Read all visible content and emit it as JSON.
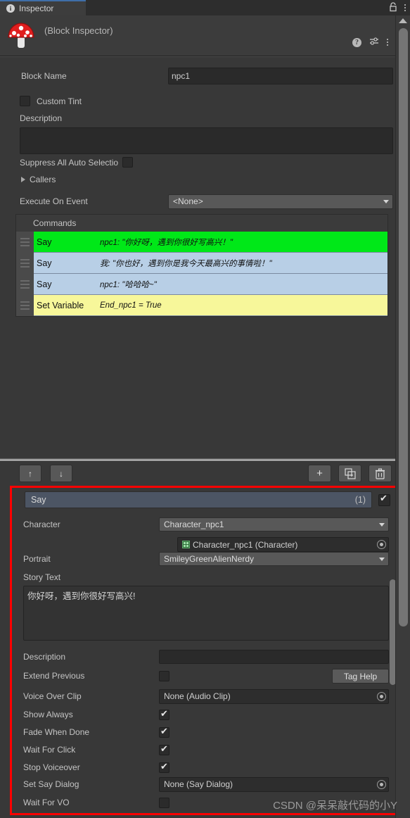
{
  "window": {
    "tab_label": "Inspector",
    "tab_icon": "info-icon",
    "lock_icon": "lock-icon",
    "tab_menu_icon": "kebab-menu-icon"
  },
  "header": {
    "title": "(Block Inspector)",
    "logo_icon": "mushroom-icon",
    "help_icon": "help-icon",
    "preset_icon": "preset-sliders-icon",
    "menu_icon": "kebab-menu-icon"
  },
  "block": {
    "block_name_label": "Block Name",
    "block_name_value": "npc1",
    "custom_tint_label": "Custom Tint",
    "custom_tint_checked": false,
    "description_label": "Description",
    "description_value": "",
    "suppress_label": "Suppress All Auto Selectio",
    "suppress_checked": false,
    "callers_label": "Callers",
    "execute_on_event_label": "Execute On Event",
    "execute_on_event_value": "<None>"
  },
  "commands": {
    "header": "Commands",
    "rows": [
      {
        "name": "Say",
        "summary": "npc1: \"你好呀，遇到你很好写高兴！\"",
        "color": "#00e818",
        "selected": true
      },
      {
        "name": "Say",
        "summary": "我: \"你也好，遇到你是我今天最高兴的事情啦！\"",
        "color": "#b8cfe6",
        "selected": false
      },
      {
        "name": "Say",
        "summary": "npc1: \"哈哈哈~\"",
        "color": "#b8cfe6",
        "selected": false
      },
      {
        "name": "Set Variable",
        "summary": "End_npc1 = True",
        "color": "#f7f79a",
        "selected": false
      }
    ]
  },
  "toolbar": {
    "move_up_label": "↑",
    "move_down_label": "↓",
    "add_label": "+",
    "duplicate_label": "duplicate-icon",
    "delete_label": "trash-icon"
  },
  "say_command": {
    "title": "Say",
    "index": "(1)",
    "enabled": true,
    "character_label": "Character",
    "character_value": "Character_npc1",
    "character_object_value": "Character_npc1 (Character)",
    "portrait_label": "Portrait",
    "portrait_value": "SmileyGreenAlienNerdy",
    "story_text_label": "Story Text",
    "story_text_value": "你好呀，遇到你很好写高兴!",
    "description_label": "Description",
    "description_value": "",
    "extend_previous_label": "Extend Previous",
    "extend_previous_checked": false,
    "tag_help_label": "Tag Help",
    "voice_over_clip_label": "Voice Over Clip",
    "voice_over_clip_value": "None (Audio Clip)",
    "show_always_label": "Show Always",
    "show_always_checked": true,
    "fade_when_done_label": "Fade When Done",
    "fade_when_done_checked": true,
    "wait_for_click_label": "Wait For Click",
    "wait_for_click_checked": true,
    "stop_voiceover_label": "Stop Voiceover",
    "stop_voiceover_checked": true,
    "set_say_dialog_label": "Set Say Dialog",
    "set_say_dialog_value": "None (Say Dialog)",
    "wait_for_vo_label": "Wait For VO",
    "wait_for_vo_checked": false
  },
  "watermark": "CSDN @呆呆敲代码的小Y",
  "colors": {
    "accent_tab": "#3f6ea8",
    "highlight_box": "#fe0000",
    "selected_command": "#00e818",
    "say_command": "#b8cfe6",
    "set_variable_command": "#f7f79a"
  }
}
